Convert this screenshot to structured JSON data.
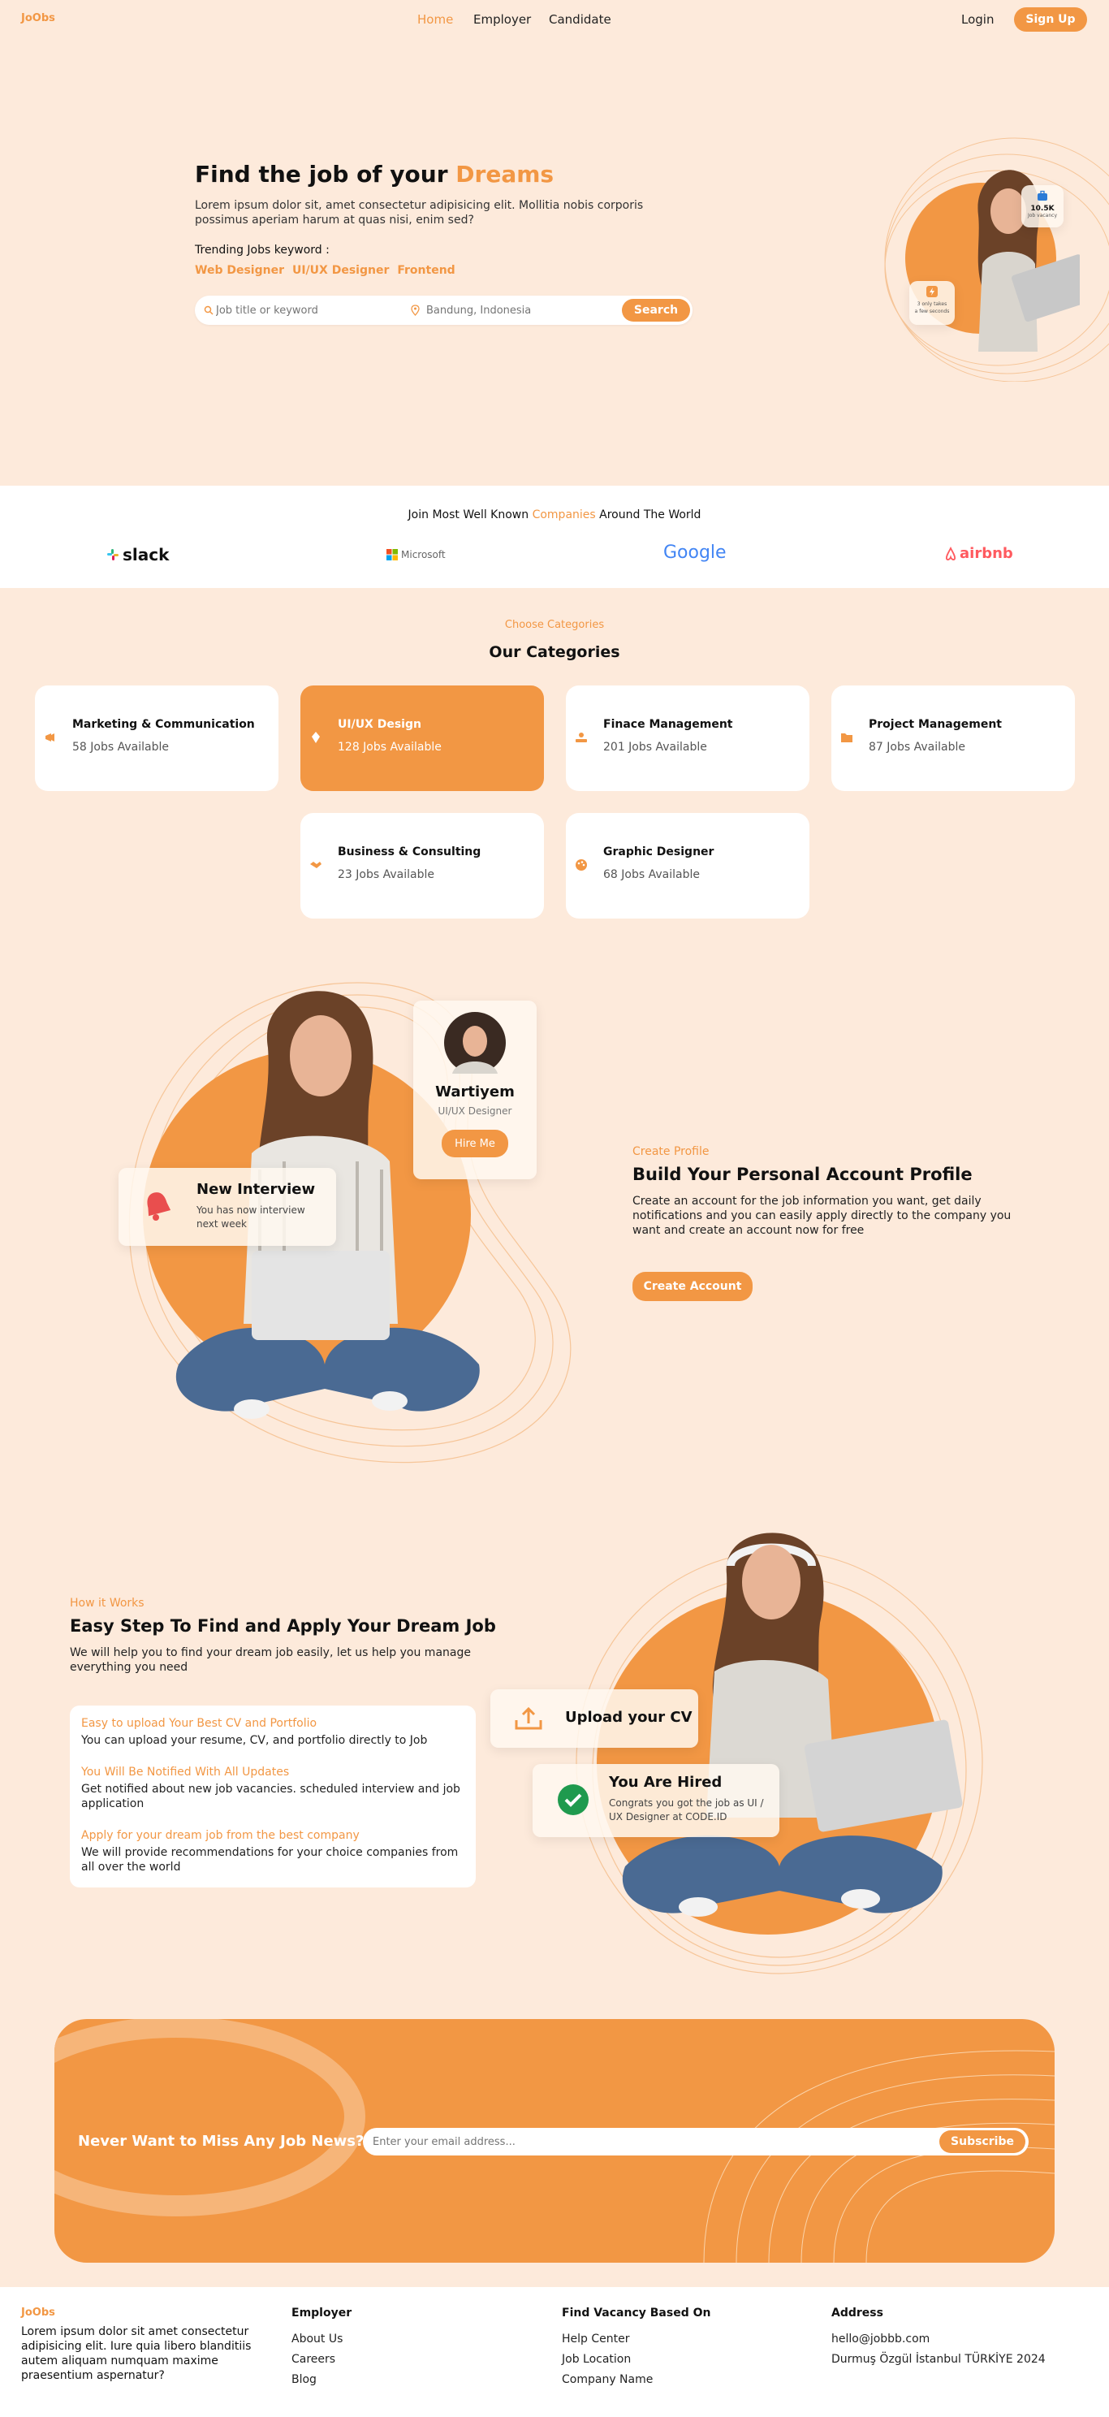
{
  "nav": {
    "logo": "JoObs",
    "links": [
      "Home",
      "Employer",
      "Candidate"
    ],
    "login": "Login",
    "signup": "Sign Up"
  },
  "hero": {
    "title_main": "Find the job of your",
    "title_accent": "Dreams",
    "description": "Lorem ipsum dolor sit, amet consectetur adipisicing elit. Mollitia nobis corporis possimus aperiam harum at quas nisi, enim sed?",
    "trending_label": "Trending Jobs keyword :",
    "trending": [
      "Web Designer",
      "UI/UX Designer",
      "Frontend"
    ],
    "search_placeholder": "Job title or keyword",
    "location_placeholder": "Bandung, Indonesia",
    "search_button": "Search",
    "badge_count": "10.5K",
    "badge_text": "Job vacancy",
    "apply_text_1": "3 only takes",
    "apply_text_2": "a few seconds"
  },
  "companies": {
    "heading_pre": "Join Most Well Known",
    "heading_accent": "Companies",
    "heading_post": "Around The World",
    "logos": [
      "slack",
      "Microsoft",
      "Google",
      "airbnb"
    ]
  },
  "categories": {
    "kicker": "Choose Categories",
    "title": "Our Categories",
    "items": [
      {
        "title": "Marketing & Communication",
        "jobs": "58 Jobs Available",
        "icon": "megaphone-icon"
      },
      {
        "title": "UI/UX Design",
        "jobs": "128 Jobs Available",
        "icon": "design-icon"
      },
      {
        "title": "Finace Management",
        "jobs": "201 Jobs Available",
        "icon": "finance-icon"
      },
      {
        "title": "Project Management",
        "jobs": "87 Jobs Available",
        "icon": "folder-icon"
      },
      {
        "title": "Business & Consulting",
        "jobs": "23 Jobs Available",
        "icon": "handshake-icon"
      },
      {
        "title": "Graphic Designer",
        "jobs": "68 Jobs Available",
        "icon": "palette-icon"
      }
    ]
  },
  "profile": {
    "kicker": "Create Profile",
    "title": "Build Your Personal Account Profile",
    "text": "Create an account for the job information you want, get daily notifications and you can easily apply directly to the company you want and create an account now for free",
    "button": "Create Account",
    "candidate_name": "Wartiyem",
    "candidate_role": "UI/UX Designer",
    "hire_button": "Hire Me",
    "notif_title": "New Interview",
    "notif_text": "You has now interview next week"
  },
  "how": {
    "kicker": "How it Works",
    "title": "Easy Step To Find and Apply Your Dream Job",
    "text": "We will help you to find your dream job easily, let us help you manage everything you need",
    "steps": [
      {
        "title": "Easy to upload Your Best CV and Portfolio",
        "text": "You can upload your resume, CV, and portfolio directly to Job"
      },
      {
        "title": "You Will Be Notified With All Updates",
        "text": "Get notified about new job vacancies. scheduled interview and job application"
      },
      {
        "title": "Apply for your dream job from the best company",
        "text": "We will provide recommendations for your choice companies from all over the world"
      }
    ],
    "upload_label": "Upload your CV",
    "hired_title": "You Are Hired",
    "hired_text": "Congrats you got the job as UI / UX Designer at CODE.ID"
  },
  "newsletter": {
    "title": "Never Want to Miss Any Job News?",
    "placeholder": "Enter your email address...",
    "button": "Subscribe"
  },
  "footer": {
    "logo": "JoObs",
    "about": "Lorem ipsum dolor sit amet consectetur adipisicing elit. Iure quia libero blanditiis autem aliquam numquam maxime praesentium aspernatur?",
    "col1_title": "Employer",
    "col1_links": [
      "About Us",
      "Careers",
      "Blog"
    ],
    "col2_title": "Find Vacancy Based On",
    "col2_links": [
      "Help Center",
      "Job Location",
      "Company Name"
    ],
    "col3_title": "Address",
    "email": "hello@jobbb.com",
    "address": "Durmuş Özgül İstanbul TÜRKİYE 2024"
  },
  "colors": {
    "accent": "#f29744",
    "background": "#fdeadb",
    "white": "#ffffff"
  }
}
